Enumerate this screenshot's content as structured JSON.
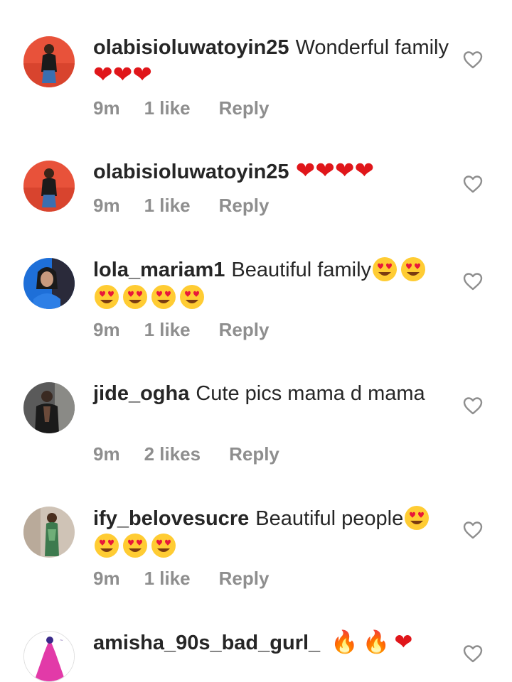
{
  "comments": [
    {
      "username": "olabisioluwatoyin25",
      "text": "Wonderful family",
      "emojis": "❤❤❤",
      "time": "9m",
      "likes": "1 like",
      "reply": "Reply",
      "avatar": "avatar-red-bg"
    },
    {
      "username": "olabisioluwatoyin25",
      "text": "",
      "emojis": "❤❤❤❤",
      "time": "9m",
      "likes": "1 like",
      "reply": "Reply",
      "avatar": "avatar-red-bg"
    },
    {
      "username": "lola_mariam1",
      "text": "Beautiful family",
      "emojis": "😍😍😍😍😍😍",
      "time": "9m",
      "likes": "1 like",
      "reply": "Reply",
      "avatar": "avatar-blue-bg"
    },
    {
      "username": "jide_ogha",
      "text": "Cute pics mama d mama",
      "emojis": "",
      "time": "9m",
      "likes": "2 likes",
      "reply": "Reply",
      "avatar": "avatar-grey-bg"
    },
    {
      "username": "ify_belovesucre",
      "text": "Beautiful people",
      "emojis": "😍😍😍😍",
      "time": "9m",
      "likes": "1 like",
      "reply": "Reply",
      "avatar": "avatar-room-bg"
    },
    {
      "username": "amisha_90s_bad_gurl_",
      "text": "",
      "emojis": "🔥🔥❤",
      "time": "",
      "likes": "",
      "reply": "",
      "avatar": "avatar-pink-logo"
    }
  ],
  "colors": {
    "username": "#262626",
    "meta": "#8e8e8e",
    "heart": "#e0161a",
    "like_icon": "#8e8e8e"
  },
  "icons": {
    "like": "heart-outline-icon"
  }
}
